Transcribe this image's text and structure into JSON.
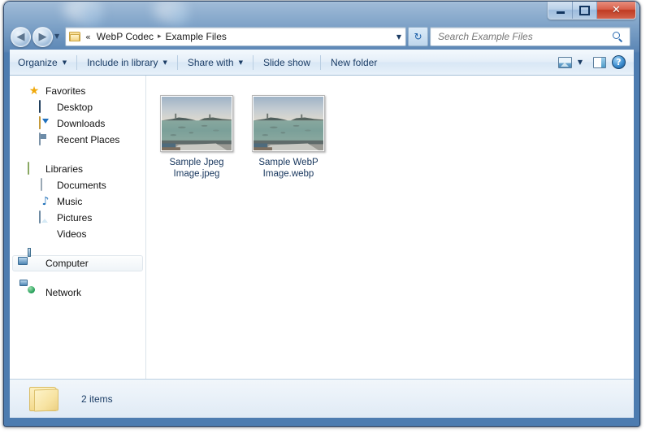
{
  "window": {
    "controls": {
      "minimize_label": "Minimize",
      "maximize_label": "Restore",
      "close_label": "Close",
      "close_glyph": "✕"
    }
  },
  "navbar": {
    "back_label": "Back",
    "back_glyph": "◀",
    "forward_label": "Forward",
    "forward_glyph": "▶",
    "recent_pages_glyph": "▼",
    "breadcrumb": {
      "overflow_glyph": "«",
      "separator_glyph": "▸",
      "items": [
        {
          "label": "WebP Codec"
        },
        {
          "label": "Example Files"
        }
      ],
      "dropdown_glyph": "▼"
    },
    "refresh_glyph": "↻",
    "refresh_label": "Refresh"
  },
  "search": {
    "placeholder": "Search Example Files",
    "value": ""
  },
  "commandbar": {
    "items": [
      {
        "label": "Organize",
        "has_caret": true,
        "caret_glyph": "▼"
      },
      {
        "label": "Include in library",
        "has_caret": true,
        "caret_glyph": "▼"
      },
      {
        "label": "Share with",
        "has_caret": true,
        "caret_glyph": "▼"
      },
      {
        "label": "Slide show",
        "has_caret": false,
        "caret_glyph": ""
      },
      {
        "label": "New folder",
        "has_caret": false,
        "caret_glyph": ""
      }
    ],
    "view_caret_glyph": "▼",
    "view_label": "Change your view",
    "preview_pane_label": "Show the preview pane",
    "help_label": "Get help",
    "help_glyph": "?"
  },
  "navpane": {
    "groups": [
      {
        "name": "favorites",
        "header": {
          "label": "Favorites",
          "icon": "star-icon"
        },
        "items": [
          {
            "label": "Desktop",
            "icon": "desktop-monitor-icon"
          },
          {
            "label": "Downloads",
            "icon": "downloads-folder-icon"
          },
          {
            "label": "Recent Places",
            "icon": "recent-places-icon"
          }
        ]
      },
      {
        "name": "libraries",
        "header": {
          "label": "Libraries",
          "icon": "libraries-icon"
        },
        "items": [
          {
            "label": "Documents",
            "icon": "document-icon"
          },
          {
            "label": "Music",
            "icon": "music-note-icon"
          },
          {
            "label": "Pictures",
            "icon": "pictures-icon"
          },
          {
            "label": "Videos",
            "icon": "video-film-icon"
          }
        ]
      },
      {
        "name": "computer",
        "header": {
          "label": "Computer",
          "icon": "computer-icon",
          "highlighted": true
        },
        "items": []
      },
      {
        "name": "network",
        "header": {
          "label": "Network",
          "icon": "network-icon"
        },
        "items": []
      }
    ]
  },
  "files": {
    "items": [
      {
        "name": "Sample Jpeg Image.jpeg",
        "thumbnail_alt": "harbor seascape photo thumbnail"
      },
      {
        "name": "Sample WebP Image.webp",
        "thumbnail_alt": "harbor seascape photo thumbnail"
      }
    ]
  },
  "statusbar": {
    "folder_icon": "folder-icon",
    "item_count_text": "2 items"
  },
  "colors": {
    "frame_blue": "#4d7cb0",
    "close_red": "#bf3a22",
    "link_blue": "#1b3d66",
    "filename_blue": "#17365d",
    "commandbar_bg": "#e4eef8"
  }
}
